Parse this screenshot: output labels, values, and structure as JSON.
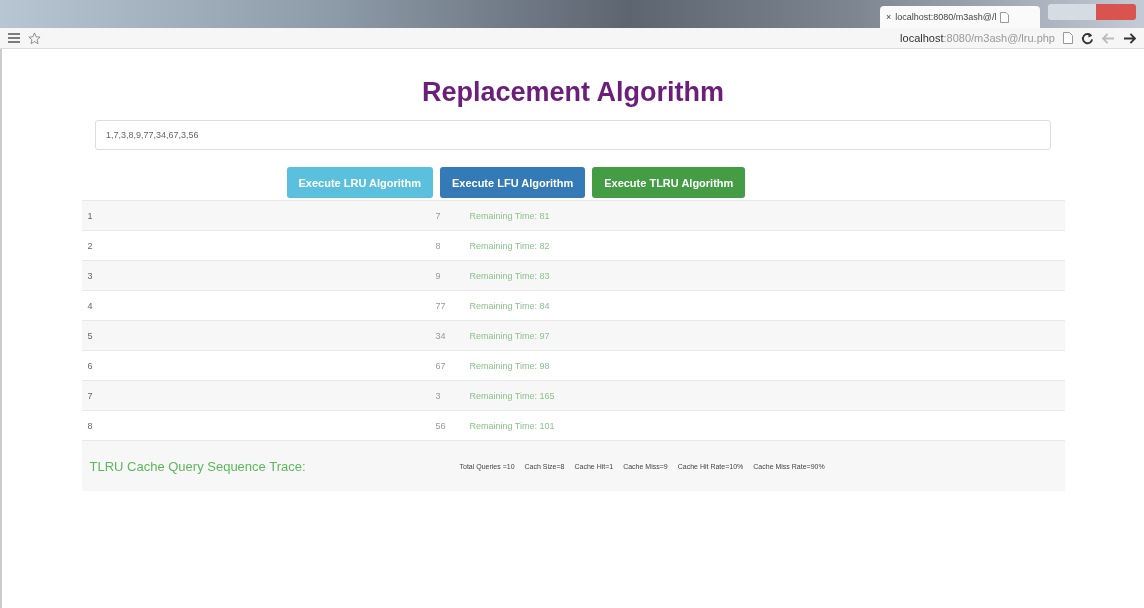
{
  "browser": {
    "tab_close": "×",
    "tab_title": "localhost:8080/m3ash@/l",
    "address_host": "localhost",
    "address_path": ":8080/m3ash@/lru.php"
  },
  "title": "Replacement Algorithm",
  "sequence_input": {
    "value": "1,7,3,8,9,77,34,67,3,56"
  },
  "buttons": [
    {
      "label": "Execute LRU Algorithm",
      "kind": "info"
    },
    {
      "label": "Execute LFU Algorithm",
      "kind": "primary"
    },
    {
      "label": "Execute TLRU Algorithm",
      "kind": "success"
    }
  ],
  "rows": [
    {
      "index": "1",
      "page": "7",
      "remaining": "Remaining Time: 81"
    },
    {
      "index": "2",
      "page": "8",
      "remaining": "Remaining Time: 82"
    },
    {
      "index": "3",
      "page": "9",
      "remaining": "Remaining Time: 83"
    },
    {
      "index": "4",
      "page": "77",
      "remaining": "Remaining Time: 84"
    },
    {
      "index": "5",
      "page": "34",
      "remaining": "Remaining Time: 97"
    },
    {
      "index": "6",
      "page": "67",
      "remaining": "Remaining Time: 98"
    },
    {
      "index": "7",
      "page": "3",
      "remaining": "Remaining Time: 165"
    },
    {
      "index": "8",
      "page": "56",
      "remaining": "Remaining Time: 101"
    }
  ],
  "trace": {
    "label": "TLRU Cache Query Sequence Trace:",
    "stats": [
      "Total Queries =10",
      "Cach Size=8",
      "Cache Hit=1",
      "Cache Miss=9",
      "Cache Hit Rate=10%",
      "Cache Miss Rate=90%"
    ]
  }
}
